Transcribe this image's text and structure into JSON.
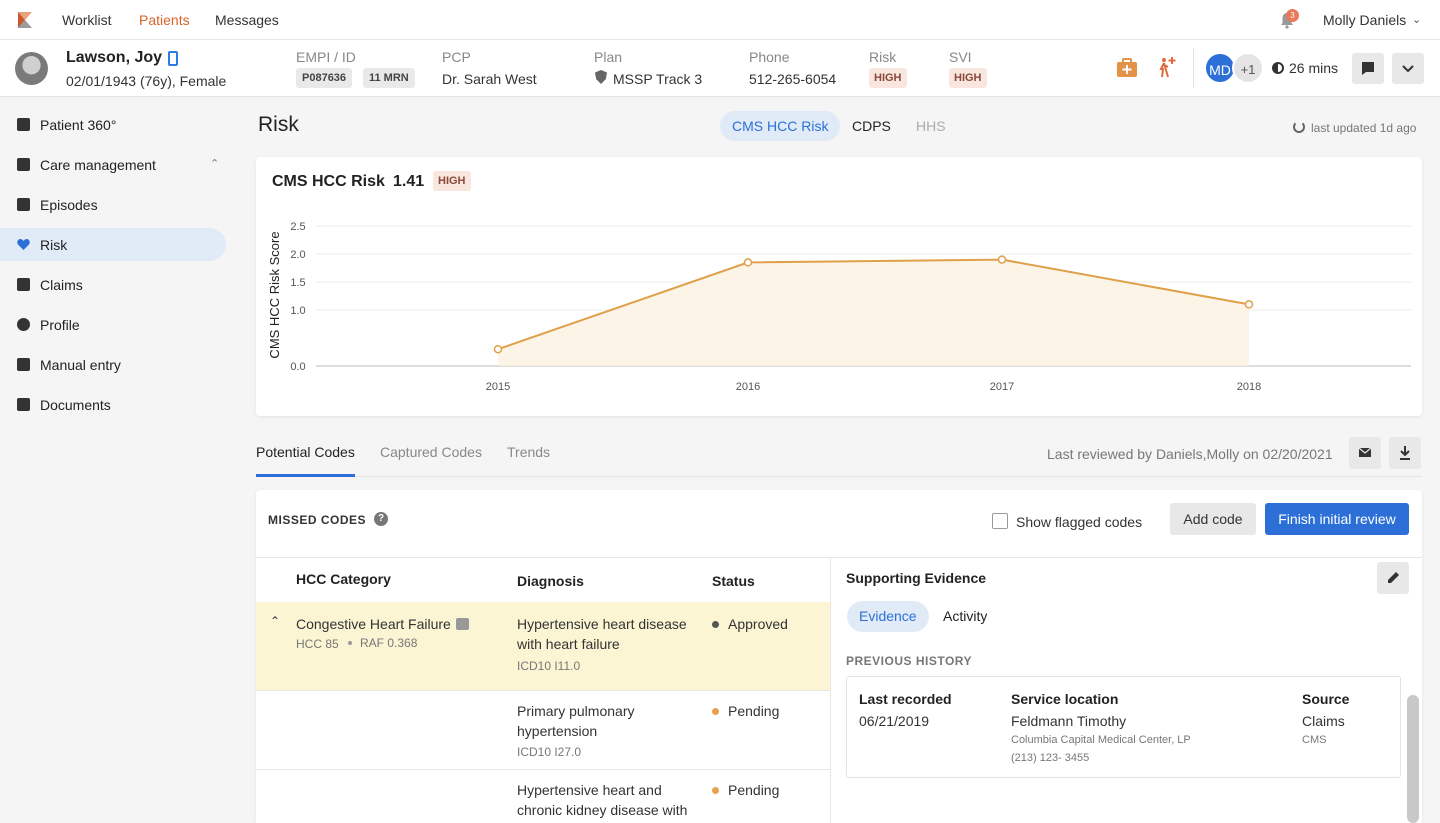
{
  "nav": {
    "links": [
      "Worklist",
      "Patients",
      "Messages"
    ],
    "notification_count": "3",
    "user": "Molly Daniels"
  },
  "patient": {
    "name": "Lawson, Joy",
    "dob": "02/01/1943 (76y), Female",
    "empi_label": "EMPI / ID",
    "empi": "P087636",
    "mrn": "11 MRN",
    "pcp_label": "PCP",
    "pcp": "Dr. Sarah West",
    "plan_label": "Plan",
    "plan": "MSSP Track 3",
    "phone_label": "Phone",
    "phone": "512-265-6054",
    "risk_label": "Risk",
    "risk": "HIGH",
    "svi_label": "SVI",
    "svi": "HIGH"
  },
  "header_actions": {
    "md_initials": "MD",
    "plus_count": "+1",
    "timer": "26 mins"
  },
  "sidebar": {
    "items": [
      {
        "label": "Patient 360°",
        "icon": "clipboard-icon"
      },
      {
        "label": "Care management",
        "icon": "chat-icon"
      },
      {
        "label": "Episodes",
        "icon": "handshake-icon"
      },
      {
        "label": "Risk",
        "icon": "heart-icon"
      },
      {
        "label": "Claims",
        "icon": "list-icon"
      },
      {
        "label": "Profile",
        "icon": "person-icon"
      },
      {
        "label": "Manual entry",
        "icon": "edit-icon"
      },
      {
        "label": "Documents",
        "icon": "folder-icon"
      }
    ]
  },
  "main": {
    "title": "Risk",
    "tabs": [
      "CMS HCC Risk",
      "CDPS",
      "HHS"
    ],
    "updated": "last updated 1d ago"
  },
  "chart_card": {
    "title": "CMS HCC Risk",
    "score": "1.41",
    "level": "HIGH"
  },
  "chart_data": {
    "type": "area",
    "categories": [
      "2015",
      "2016",
      "2017",
      "2018"
    ],
    "values": [
      0.3,
      1.85,
      1.9,
      1.1
    ],
    "ylabel": "CMS HCC Risk Score",
    "yticks": [
      "0.0",
      "1.0",
      "1.5",
      "2.0",
      "2.5"
    ],
    "ylim": [
      0,
      2.5
    ],
    "color": "#e0a04a"
  },
  "codes": {
    "tabs": [
      "Potential Codes",
      "Captured Codes",
      "Trends"
    ],
    "reviewed": "Last reviewed by Daniels,Molly on 02/20/2021",
    "panel_title": "MISSED CODES",
    "show_flagged": "Show flagged codes",
    "add_code": "Add code",
    "finish": "Finish initial review",
    "columns": [
      "HCC Category",
      "Diagnosis",
      "Status"
    ],
    "rows": [
      {
        "category": "Congestive Heart Failure",
        "hcc": "HCC 85",
        "raf": "RAF 0.368",
        "diagnosis": [
          "Hypertensive heart disease",
          "with heart failure"
        ],
        "code": "ICD10 I11.0",
        "status": "Approved",
        "status_color": "#555555"
      },
      {
        "diagnosis": [
          "Primary pulmonary",
          "hypertension"
        ],
        "code": "ICD10 I27.0",
        "status": "Pending",
        "status_color": "#e8a04a"
      },
      {
        "diagnosis": [
          "Hypertensive heart and",
          "chronic kidney disease with"
        ],
        "status": "Pending",
        "status_color": "#e8a04a"
      }
    ]
  },
  "evidence": {
    "title": "Supporting Evidence",
    "tabs": [
      "Evidence",
      "Activity"
    ],
    "history_title": "PREVIOUS HISTORY",
    "last_recorded_label": "Last recorded",
    "last_recorded": "06/21/2019",
    "service_label": "Service location",
    "service": "Feldmann Timothy",
    "service_detail": "Columbia Capital Medical Center, LP",
    "service_phone": "(213) 123- 3455",
    "source_label": "Source",
    "source": "Claims",
    "source_detail": "CMS"
  }
}
